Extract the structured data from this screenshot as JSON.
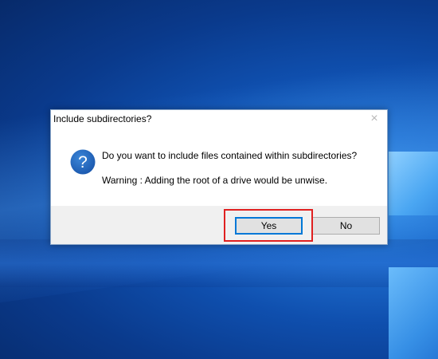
{
  "dialog": {
    "title": "Include subdirectories?",
    "close_icon": "close-icon",
    "question_icon": "question-icon",
    "message": "Do you want to include files contained within subdirectories?",
    "warning": "Warning : Adding the root of a drive would be unwise.",
    "buttons": {
      "yes": "Yes",
      "no": "No"
    },
    "default_button": "yes"
  },
  "colors": {
    "accent": "#0078d7",
    "icon_blue": "#1c5fb8",
    "highlight": "#e02020",
    "footer_bg": "#f0f0f0"
  },
  "icons": {
    "close": "×"
  }
}
